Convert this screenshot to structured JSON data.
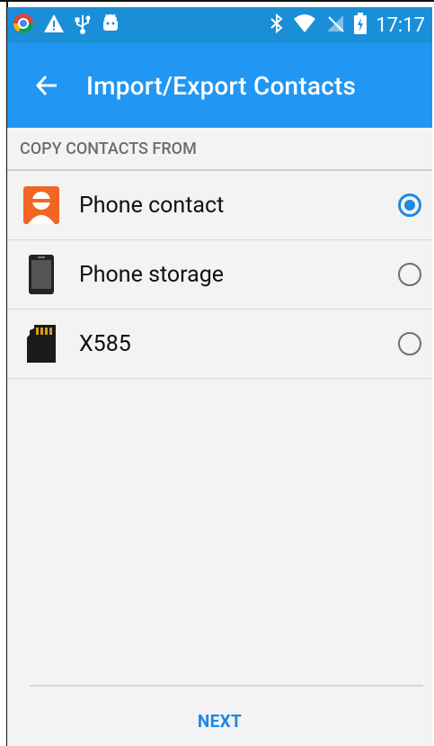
{
  "status_bar": {
    "time": "17:17",
    "icons_left": [
      "chrome-icon",
      "warning-icon",
      "usb-icon",
      "android-icon"
    ],
    "icons_right": [
      "bluetooth-icon",
      "wifi-icon",
      "no-signal-icon",
      "battery-icon"
    ]
  },
  "app_bar": {
    "title": "Import/Export Contacts",
    "back_icon": "arrow-left-icon"
  },
  "section": {
    "header": "COPY CONTACTS FROM"
  },
  "options": [
    {
      "label": "Phone contact",
      "icon": "contact-avatar-icon",
      "selected": true
    },
    {
      "label": "Phone storage",
      "icon": "phone-device-icon",
      "selected": false
    },
    {
      "label": "X585",
      "icon": "sd-card-icon",
      "selected": false
    }
  ],
  "footer": {
    "next_label": "NEXT"
  },
  "colors": {
    "status_bar": "#1a8fd8",
    "app_bar": "#2196f3",
    "accent": "#1e88e5",
    "background": "#f3f3f3"
  }
}
